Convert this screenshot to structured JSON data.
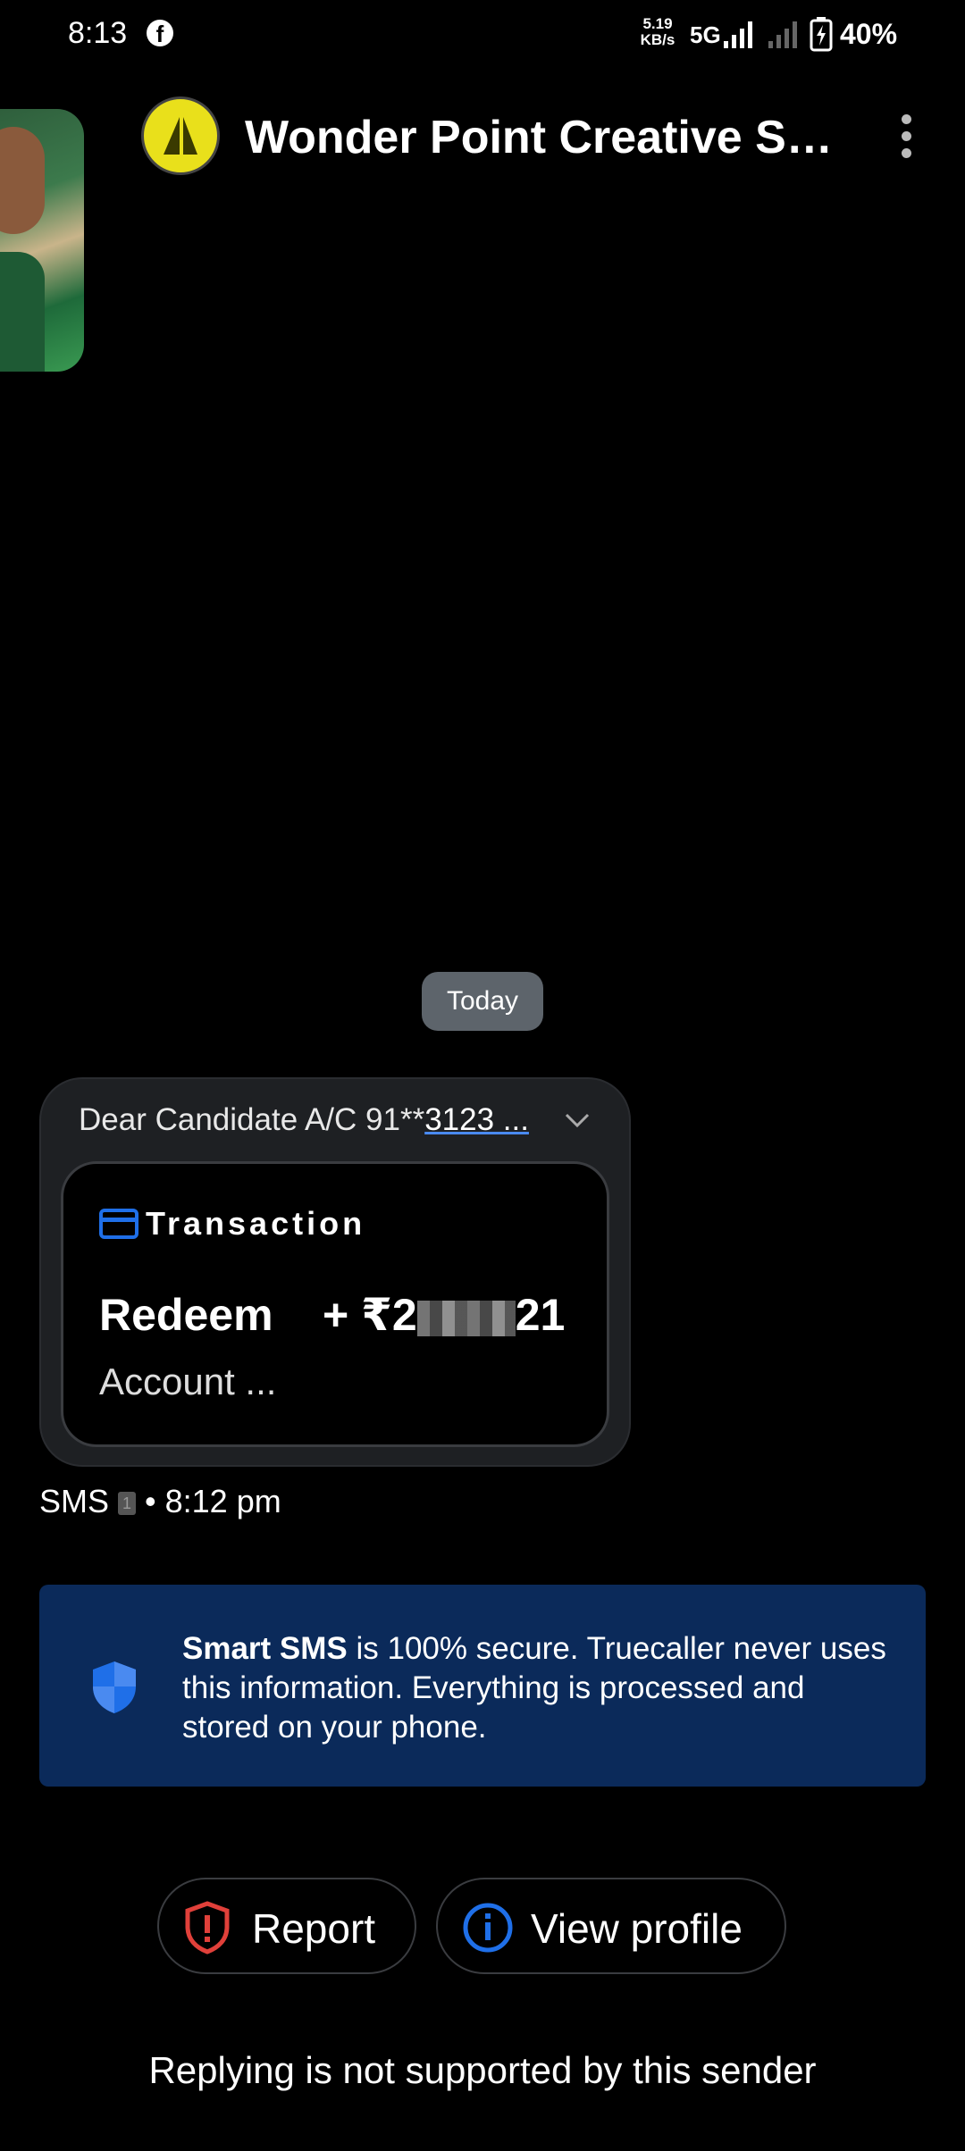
{
  "status_bar": {
    "time": "8:13",
    "net_speed_value": "5.19",
    "net_speed_unit": "KB/s",
    "network": "5G",
    "battery": "40%"
  },
  "header": {
    "title": "Wonder Point Creative Solu..."
  },
  "date_chip": "Today",
  "message": {
    "preview_prefix": "Dear Candidate A/C 91**",
    "preview_link": "3123 ...",
    "card": {
      "title": "Transaction",
      "label": "Redeem",
      "amount_prefix": "+ ₹2",
      "amount_suffix": "21",
      "account": "Account ..."
    },
    "meta_type": "SMS",
    "meta_sim": "1",
    "meta_time": "8:12 pm"
  },
  "banner": {
    "bold": "Smart SMS",
    "text": " is 100% secure. Truecaller never uses this information. Everything is processed and stored on your phone."
  },
  "actions": {
    "report": "Report",
    "view_profile": "View profile"
  },
  "footer_note": "Replying is not supported by this sender",
  "colors": {
    "background": "#000000",
    "banner": "#0b2a5a",
    "accent_blue": "#1f6fe8",
    "report_red": "#e0403a",
    "avatar_yellow": "#e9e01b"
  },
  "icons": [
    "facebook-icon",
    "signal-icon",
    "battery-charging-icon",
    "more-vert-icon",
    "chevron-down-icon",
    "card-icon",
    "shield-icon",
    "report-shield-icon",
    "info-icon"
  ]
}
